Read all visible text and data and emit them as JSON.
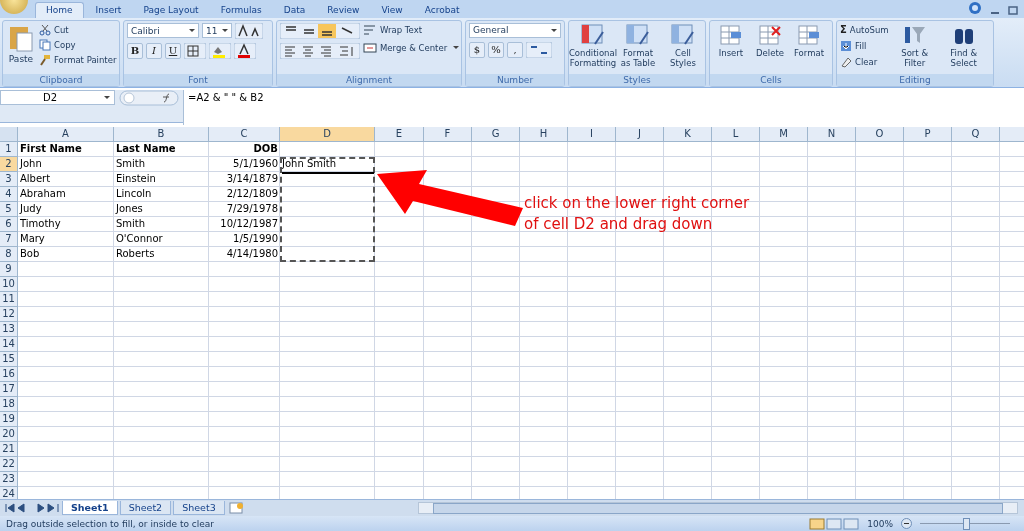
{
  "ribbon_tabs": [
    {
      "label": "Home",
      "selected": true
    },
    {
      "label": "Insert",
      "selected": false
    },
    {
      "label": "Page Layout",
      "selected": false
    },
    {
      "label": "Formulas",
      "selected": false
    },
    {
      "label": "Data",
      "selected": false
    },
    {
      "label": "Review",
      "selected": false
    },
    {
      "label": "View",
      "selected": false
    },
    {
      "label": "Acrobat",
      "selected": false
    }
  ],
  "ribbon": {
    "clipboard": {
      "label": "Clipboard",
      "paste": "Paste",
      "cut": "Cut",
      "copy": "Copy",
      "painter": "Format Painter"
    },
    "font": {
      "label": "Font",
      "font_name": "Calibri",
      "font_size": "11",
      "bold": "B",
      "italic": "I",
      "underline": "U"
    },
    "alignment": {
      "label": "Alignment",
      "wrap": "Wrap Text",
      "merge": "Merge & Center"
    },
    "number": {
      "label": "Number",
      "format": "General",
      "currency": "$",
      "percent": "%",
      "comma": ","
    },
    "styles": {
      "label": "Styles",
      "commands": [
        "Conditional Formatting",
        "Format as Table",
        "Cell Styles"
      ]
    },
    "cells": {
      "label": "Cells",
      "commands": [
        "Insert",
        "Delete",
        "Format"
      ]
    },
    "editing": {
      "label": "Editing",
      "sigma": "Σ",
      "autosum": "AutoSum",
      "fill": "Fill",
      "clear": "Clear",
      "sort": "Sort & Filter",
      "find": "Find & Select"
    }
  },
  "name_box": "D2",
  "formula": "=A2 & \" \" & B2",
  "columns": [
    {
      "label": "A",
      "selected": false,
      "kind": "text"
    },
    {
      "label": "B",
      "selected": false,
      "kind": "text"
    },
    {
      "label": "C",
      "selected": false,
      "kind": "date"
    },
    {
      "label": "D",
      "selected": true,
      "kind": "text"
    },
    {
      "label": "E",
      "selected": false
    },
    {
      "label": "F",
      "selected": false
    },
    {
      "label": "G",
      "selected": false
    },
    {
      "label": "H",
      "selected": false
    },
    {
      "label": "I",
      "selected": false
    },
    {
      "label": "J",
      "selected": false
    },
    {
      "label": "K",
      "selected": false
    },
    {
      "label": "L",
      "selected": false
    },
    {
      "label": "M",
      "selected": false
    },
    {
      "label": "N",
      "selected": false
    },
    {
      "label": "O",
      "selected": false
    },
    {
      "label": "P",
      "selected": false
    },
    {
      "label": "Q",
      "selected": false
    }
  ],
  "rows": [
    {
      "number": "1",
      "selected": false,
      "header": true,
      "cells": [
        "First Name",
        "Last Name",
        "DOB"
      ]
    },
    {
      "number": "2",
      "selected": true,
      "header": false,
      "cells": [
        "John",
        "Smith",
        "5/1/1960",
        "John Smith"
      ]
    },
    {
      "number": "3",
      "selected": false,
      "header": false,
      "cells": [
        "Albert",
        "Einstein",
        "3/14/1879"
      ]
    },
    {
      "number": "4",
      "selected": false,
      "header": false,
      "cells": [
        "Abraham",
        "Lincoln",
        "2/12/1809"
      ]
    },
    {
      "number": "5",
      "selected": false,
      "header": false,
      "cells": [
        "Judy",
        "Jones",
        "7/29/1978"
      ]
    },
    {
      "number": "6",
      "selected": false,
      "header": false,
      "cells": [
        "Timothy",
        "Smith",
        "10/12/1987"
      ]
    },
    {
      "number": "7",
      "selected": false,
      "header": false,
      "cells": [
        "Mary",
        "O'Connor",
        "1/5/1990"
      ]
    },
    {
      "number": "8",
      "selected": false,
      "header": false,
      "cells": [
        "Bob",
        "Roberts",
        "4/14/1980"
      ]
    },
    {
      "number": "9",
      "selected": false
    },
    {
      "number": "10",
      "selected": false
    },
    {
      "number": "11",
      "selected": false
    },
    {
      "number": "12",
      "selected": false
    },
    {
      "number": "13",
      "selected": false
    },
    {
      "number": "14",
      "selected": false
    },
    {
      "number": "15",
      "selected": false
    },
    {
      "number": "16",
      "selected": false
    },
    {
      "number": "17",
      "selected": false
    },
    {
      "number": "18",
      "selected": false
    },
    {
      "number": "19",
      "selected": false
    },
    {
      "number": "20",
      "selected": false
    },
    {
      "number": "21",
      "selected": false
    },
    {
      "number": "22",
      "selected": false
    },
    {
      "number": "23",
      "selected": false
    },
    {
      "number": "24",
      "selected": false
    }
  ],
  "annotation": [
    "click on the lower right corner",
    "of cell D2 and drag down"
  ],
  "sheet_tabs": [
    {
      "label": "Sheet1",
      "selected": true
    },
    {
      "label": "Sheet2",
      "selected": false
    },
    {
      "label": "Sheet3",
      "selected": false
    }
  ],
  "status_bar": {
    "message": "Drag outside selection to fill, or inside to clear",
    "zoom": "100%",
    "level": 0.5
  }
}
